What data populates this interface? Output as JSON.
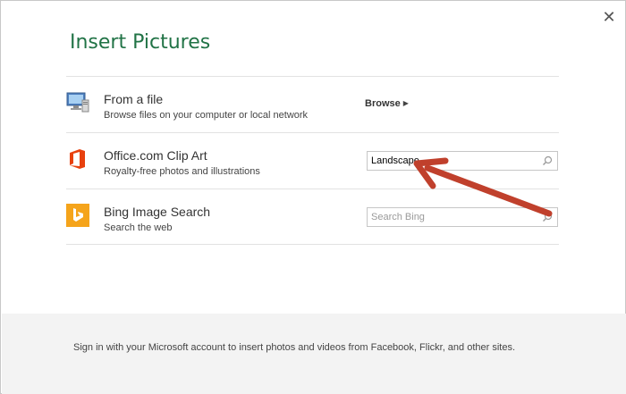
{
  "dialog": {
    "title": "Insert Pictures",
    "close_glyph": "✕"
  },
  "rows": [
    {
      "title": "From a file",
      "subtitle": "Browse files on your computer or local network",
      "action_label": "Browse",
      "icon": "computer-icon"
    },
    {
      "title": "Office.com Clip Art",
      "subtitle": "Royalty-free photos and illustrations",
      "input_value": "Landscape",
      "icon": "office-icon"
    },
    {
      "title": "Bing Image Search",
      "subtitle": "Search the web",
      "input_placeholder": "Search Bing",
      "icon": "bing-icon"
    }
  ],
  "footer": {
    "text": "Sign in with your Microsoft account to insert photos and videos from Facebook, Flickr, and other sites."
  },
  "colors": {
    "title": "#217346",
    "office": "#e8410e",
    "bing": "#f5a41b",
    "annotation_arrow": "#c0402c"
  }
}
